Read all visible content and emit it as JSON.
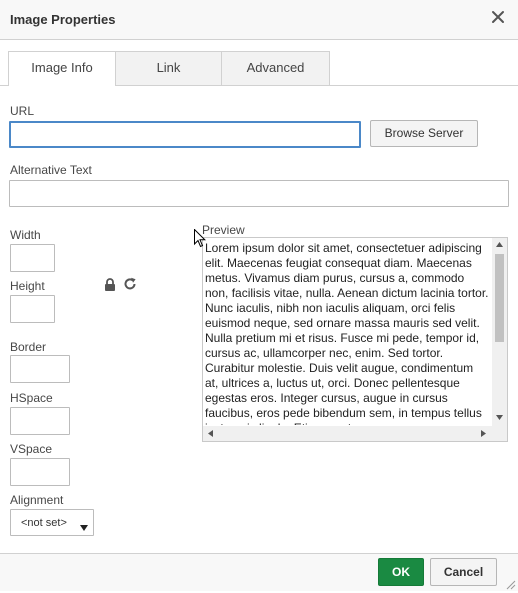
{
  "dialog": {
    "title": "Image Properties",
    "close_icon": "close-icon"
  },
  "tabs": [
    {
      "label": "Image Info",
      "active": true
    },
    {
      "label": "Link",
      "active": false
    },
    {
      "label": "Advanced",
      "active": false
    }
  ],
  "form": {
    "url_label": "URL",
    "url_value": "",
    "browse_label": "Browse Server",
    "alt_label": "Alternative Text",
    "alt_value": "",
    "width_label": "Width",
    "width_value": "",
    "height_label": "Height",
    "height_value": "",
    "lock_icon": "lock-icon",
    "reset_icon": "reset-size-icon",
    "border_label": "Border",
    "border_value": "",
    "hspace_label": "HSpace",
    "hspace_value": "",
    "vspace_label": "VSpace",
    "vspace_value": "",
    "alignment_label": "Alignment",
    "alignment_value": "<not set>"
  },
  "preview": {
    "label": "Preview",
    "text": "Lorem ipsum dolor sit amet, consectetuer adipiscing elit. Maecenas feugiat consequat diam. Maecenas metus. Vivamus diam purus, cursus a, commodo non, facilisis vitae, nulla. Aenean dictum lacinia tortor. Nunc iaculis, nibh non iaculis aliquam, orci felis euismod neque, sed ornare massa mauris sed velit. Nulla pretium mi et risus. Fusce mi pede, tempor id, cursus ac, ullamcorper nec, enim. Sed tortor. Curabitur molestie. Duis velit augue, condimentum at, ultrices a, luctus ut, orci. Donec pellentesque egestas eros. Integer cursus, augue in cursus faucibus, eros pede bibendum sem, in tempus tellus justo quis ligula. Etiam eget"
  },
  "footer": {
    "ok_label": "OK",
    "cancel_label": "Cancel"
  },
  "colors": {
    "accent": "#4b88c8",
    "ok_button": "#1a8a42"
  }
}
